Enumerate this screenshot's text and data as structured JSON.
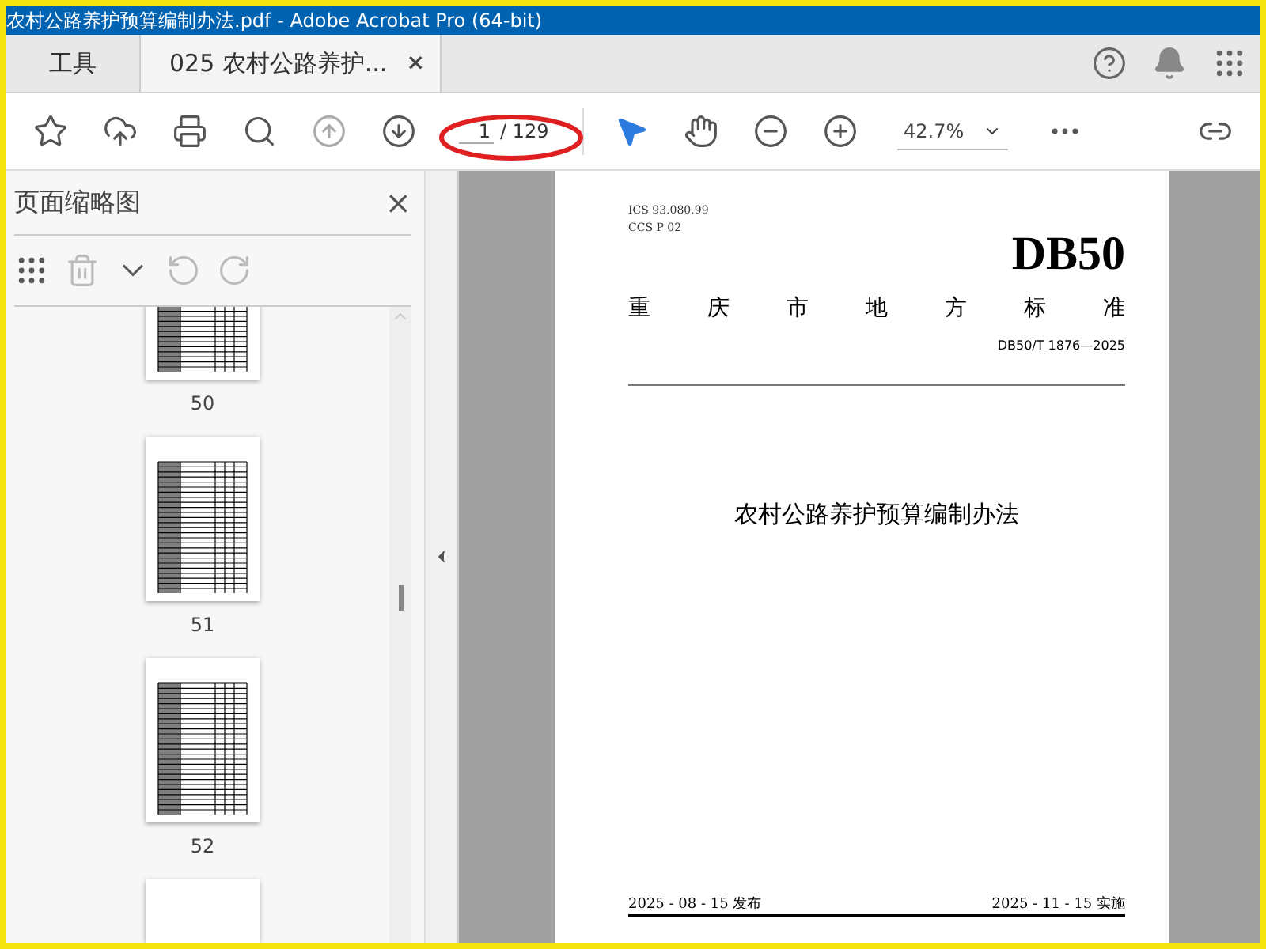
{
  "window": {
    "title": "农村公路养护预算编制办法.pdf - Adobe Acrobat Pro (64-bit)"
  },
  "tabs": [
    {
      "label": "工具",
      "selected": false
    },
    {
      "label": "025 农村公路养护...",
      "selected": true,
      "close": "×"
    }
  ],
  "toolbar": {
    "page_input": "1",
    "page_total": "/ 129",
    "zoom": "42.7%"
  },
  "thumbnails_panel": {
    "title": "页面缩略图",
    "close": "×",
    "thumbnails": [
      {
        "label": "50"
      },
      {
        "label": "51"
      },
      {
        "label": "52"
      }
    ]
  },
  "document": {
    "ics": "ICS  93.080.99",
    "ccs": "CCS  P 02",
    "code": "DB50",
    "standard_name": [
      "重",
      "庆",
      "市",
      "地",
      "方",
      "标",
      "准"
    ],
    "number": "DB50/T 1876—2025",
    "doc_title": "农村公路养护预算编制办法",
    "issue_date": "2025 - 08 - 15 发布",
    "effective_date": "2025 - 11 - 15 实施"
  }
}
